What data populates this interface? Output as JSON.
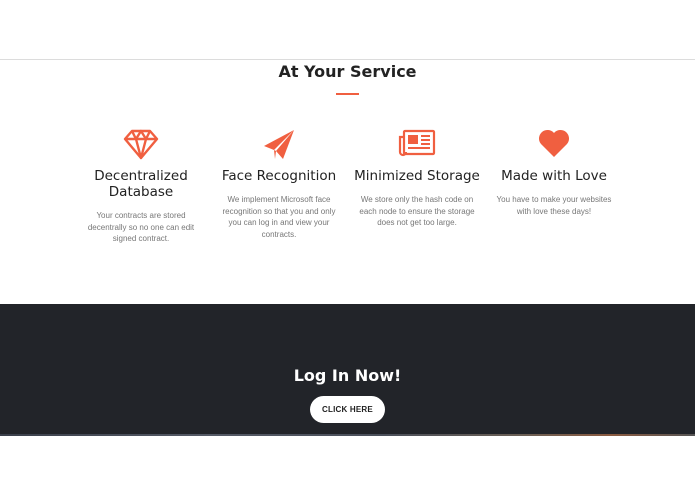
{
  "services": {
    "title": "At Your Service",
    "accent_color": "#f05f40",
    "features": [
      {
        "icon": "diamond-icon",
        "title": "Decentralized Database",
        "text": "Your contracts are stored decentrally so no one can edit signed contract."
      },
      {
        "icon": "paper-plane-icon",
        "title": "Face Recognition",
        "text": "We implement Microsoft face recognition so that you and only you can log in and view your contracts."
      },
      {
        "icon": "newspaper-icon",
        "title": "Minimized Storage",
        "text": "We store only the hash code on each node to ensure the storage does not get too large."
      },
      {
        "icon": "heart-icon",
        "title": "Made with Love",
        "text": "You have to make your websites with love these days!"
      }
    ]
  },
  "cta": {
    "title": "Log In Now!",
    "button_label": "CLICK HERE",
    "background_color": "#222429"
  }
}
